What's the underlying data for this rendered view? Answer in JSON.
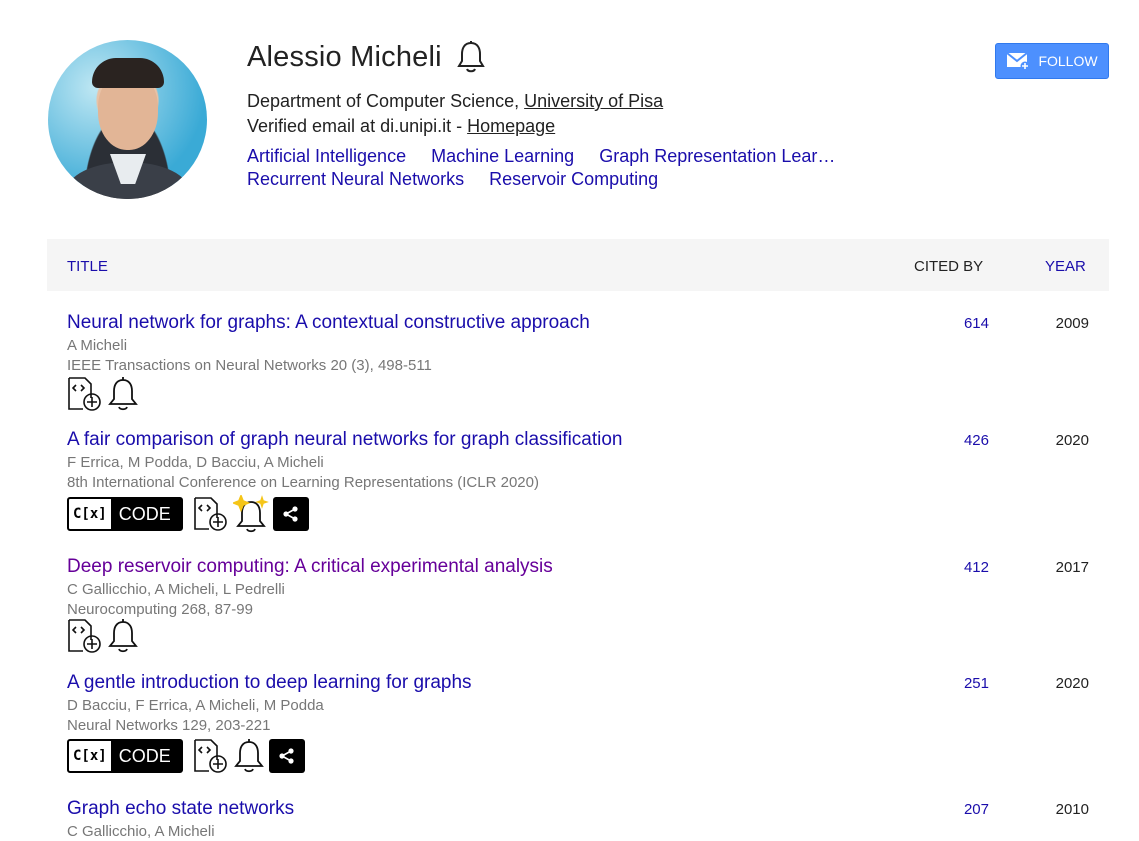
{
  "profile": {
    "name": "Alessio Micheli",
    "affiliation_prefix": "Department of Computer Science, ",
    "affiliation_link": "University of Pisa",
    "email_text": "Verified email at di.unipi.it - ",
    "homepage_link": "Homepage",
    "interests": [
      "Artificial Intelligence",
      "Machine Learning",
      "Graph Representation Lear…",
      "Recurrent Neural Networks",
      "Reservoir Computing"
    ],
    "follow_label": "FOLLOW"
  },
  "table": {
    "headers": {
      "title": "TITLE",
      "cited_by": "CITED BY",
      "year": "YEAR"
    },
    "rows": [
      {
        "title": "Neural network for graphs: A contextual constructive approach",
        "authors": "A Micheli",
        "venue": "IEEE Transactions on Neural Networks 20 (3), 498-511",
        "cited_by": "614",
        "year": "2009"
      },
      {
        "title": "A fair comparison of graph neural networks for graph classification",
        "authors": "F Errica, M Podda, D Bacciu, A Micheli",
        "venue": "8th International Conference on Learning Representations (ICLR 2020)",
        "cited_by": "426",
        "year": "2020",
        "code_label": "CODE",
        "code_prefix": "C[x]"
      },
      {
        "title": "Deep reservoir computing: A critical experimental analysis",
        "authors": "C Gallicchio, A Micheli, L Pedrelli",
        "venue": "Neurocomputing 268, 87-99",
        "cited_by": "412",
        "year": "2017"
      },
      {
        "title": "A gentle introduction to deep learning for graphs",
        "authors": "D Bacciu, F Errica, A Micheli, M Podda",
        "venue": "Neural Networks 129, 203-221",
        "cited_by": "251",
        "year": "2020",
        "code_label": "CODE",
        "code_prefix": "C[x]"
      },
      {
        "title": "Graph echo state networks",
        "authors": "C Gallicchio, A Micheli",
        "cited_by": "207",
        "year": "2010"
      }
    ]
  },
  "colors": {
    "link": "#1a0dab",
    "visited": "#660099",
    "follow_bg": "#4d90fe",
    "header_bg": "#f5f5f5",
    "meta_text": "#777777"
  },
  "icons": [
    "bell-icon",
    "mail-plus-icon",
    "code-file-add-icon",
    "bell-sparkle-icon",
    "share-icon"
  ]
}
